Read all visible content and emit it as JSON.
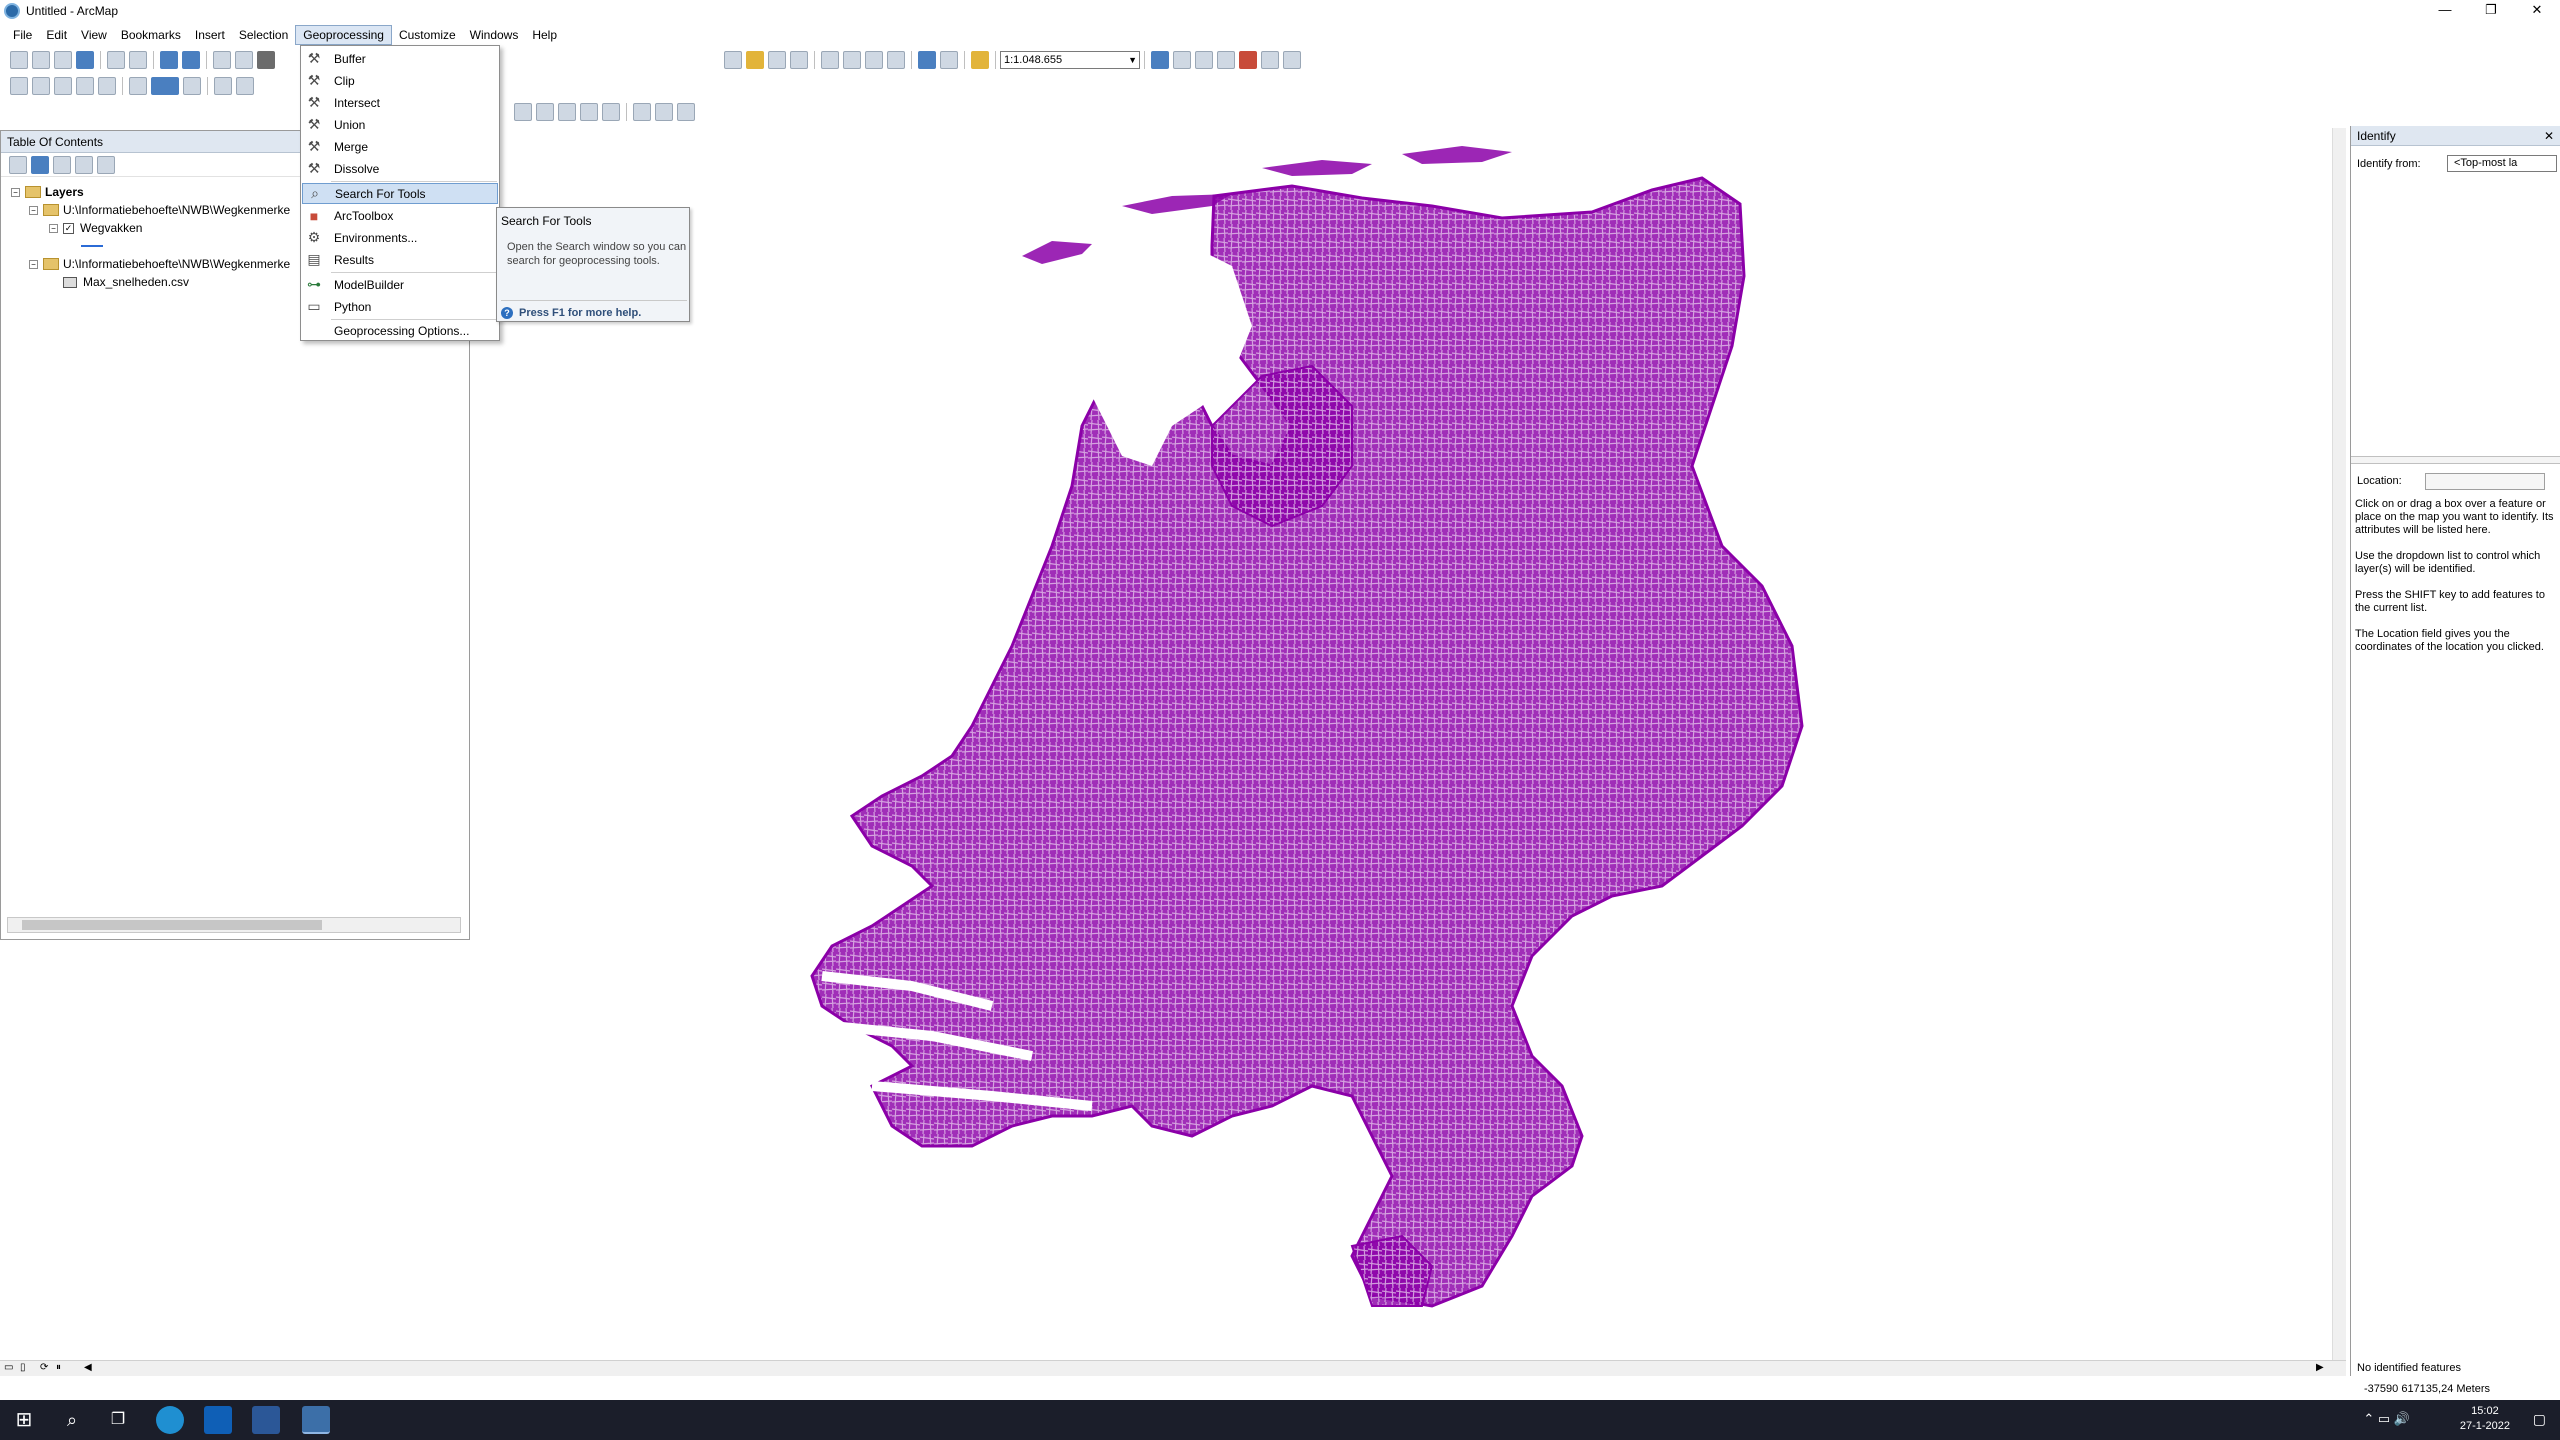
{
  "window": {
    "title": "Untitled - ArcMap",
    "min": "—",
    "restore": "❐",
    "close": "✕"
  },
  "menubar": [
    "File",
    "Edit",
    "View",
    "Bookmarks",
    "Insert",
    "Selection",
    "Geoprocessing",
    "Customize",
    "Windows",
    "Help"
  ],
  "toolbar": {
    "scale": "1:1.048.655"
  },
  "toc": {
    "title": "Table Of Contents",
    "root": "Layers",
    "folder1": "U:\\Informatiebehoefte\\NWB\\Wegkenmerke",
    "layer": "Wegvakken",
    "folder2": "U:\\Informatiebehoefte\\NWB\\Wegkenmerke",
    "table": "Max_snelheden.csv"
  },
  "geomenu": {
    "items": [
      {
        "label": "Buffer",
        "icon": "hammer-icon"
      },
      {
        "label": "Clip",
        "icon": "hammer-icon"
      },
      {
        "label": "Intersect",
        "icon": "hammer-icon"
      },
      {
        "label": "Union",
        "icon": "hammer-icon"
      },
      {
        "label": "Merge",
        "icon": "hammer-icon"
      },
      {
        "label": "Dissolve",
        "icon": "hammer-icon"
      },
      {
        "label": "Search For Tools",
        "icon": "search-window-icon"
      },
      {
        "label": "ArcToolbox",
        "icon": "toolbox-icon"
      },
      {
        "label": "Environments...",
        "icon": "environments-icon"
      },
      {
        "label": "Results",
        "icon": "results-icon"
      },
      {
        "label": "ModelBuilder",
        "icon": "modelbuilder-icon"
      },
      {
        "label": "Python",
        "icon": "python-icon"
      },
      {
        "label": "Geoprocessing Options...",
        "icon": ""
      }
    ]
  },
  "tooltip": {
    "title": "Search For Tools",
    "body": "Open the Search window so you can search for geoprocessing tools.",
    "footer": "Press F1 for more help."
  },
  "identify": {
    "title": "Identify",
    "identify_from_label": "Identify from:",
    "identify_from_value": "<Top-most la",
    "location_label": "Location:",
    "help1": "Click on or drag a box over a feature or place on the map you want to identify. Its attributes will be listed here.",
    "help2": "Use the dropdown list to control which layer(s) will be identified.",
    "help3": "Press the SHIFT key to add features to the current list.",
    "help4": "The Location field gives you the coordinates of the location you clicked.",
    "status": "No identified features"
  },
  "statusbar": {
    "coords": "-37590  617135,24 Meters"
  },
  "taskbar": {
    "time": "15:02",
    "date": "27-1-2022"
  },
  "colors": {
    "roads": "#8b00a8",
    "highlight": "#cfe0f3"
  }
}
